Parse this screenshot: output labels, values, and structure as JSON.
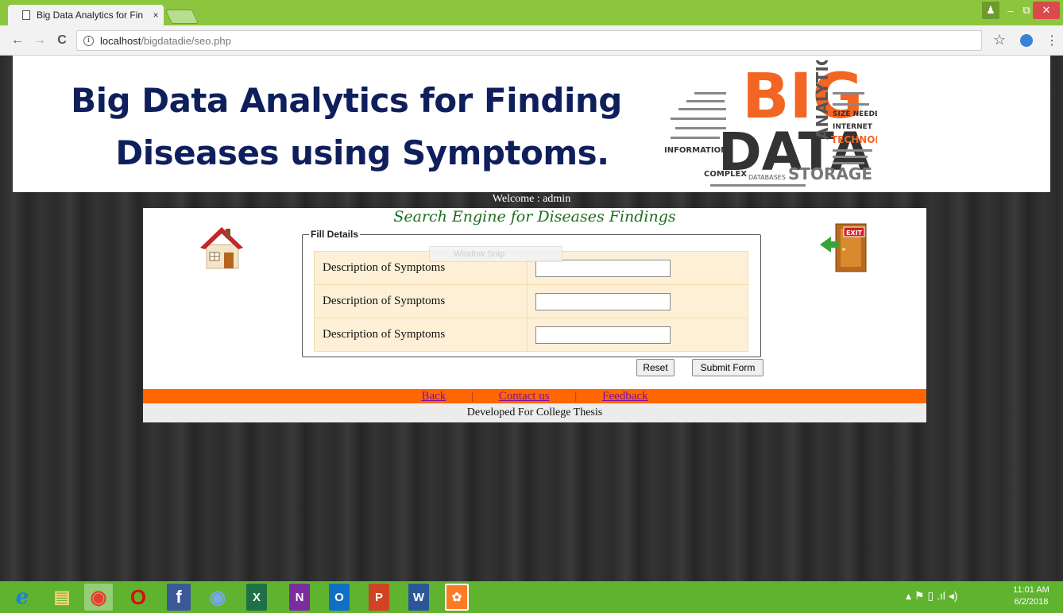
{
  "browser": {
    "tab_title": "Big Data Analytics for Fin",
    "tab_close": "×",
    "url_host": "localhost",
    "url_path": "/bigdatadie/seo.php",
    "info_glyph": "i",
    "back_glyph": "←",
    "forward_glyph": "→",
    "reload_glyph": "C",
    "star_glyph": "☆",
    "menu_glyph": "⋮",
    "window_user": "♟",
    "window_min": "–",
    "window_max": "⧉",
    "window_close": "✕"
  },
  "page": {
    "heading_line1": "Big Data Analytics for Finding",
    "heading_line2": "Diseases using Symptoms.",
    "welcome": "Welcome : admin",
    "panel_title": "Search Engine for Diseases Findings",
    "fieldset_legend": "Fill Details",
    "form_rows": [
      {
        "label": "Description of Symptoms",
        "value": ""
      },
      {
        "label": "Description of Symptoms",
        "value": ""
      },
      {
        "label": "Description of Symptoms",
        "value": ""
      }
    ],
    "reset_label": "Reset",
    "submit_label": "Submit Form",
    "links": {
      "back": "Back",
      "contact": "Contact us",
      "feedback": "Feedback",
      "sep": "|"
    },
    "footer": "Developed For College Thesis",
    "snip_overlay": "Window Snip",
    "logo": {
      "big": "BIG",
      "data": "DATA",
      "analytics": "ANALYTICS",
      "technologies": "TECHNOLOGIES",
      "storage": "STORAGE",
      "information": "INFORMATION",
      "complex": "COMPLEX",
      "internet": "INTERNET",
      "databases": "DATABASES",
      "size_needed": "SIZE NEEDED"
    },
    "exit_label": "EXIT"
  },
  "taskbar": {
    "items": [
      "e",
      "▤",
      "◉",
      "O",
      "f",
      "◉",
      "X",
      "N",
      "O",
      "P",
      "W",
      "✿"
    ],
    "tray": "▴  ⚑  ▯ .ıl ◂)",
    "time": "11:01 AM",
    "date": "6/2/2018"
  },
  "colors": {
    "chrome_green": "#8cc63f",
    "heading_navy": "#0f1f5c",
    "panel_title_green": "#1b6e1b",
    "linkbar_orange": "#ff6600",
    "form_bg": "#fdf0d6",
    "logo_orange": "#f26522",
    "logo_dark": "#333333"
  }
}
